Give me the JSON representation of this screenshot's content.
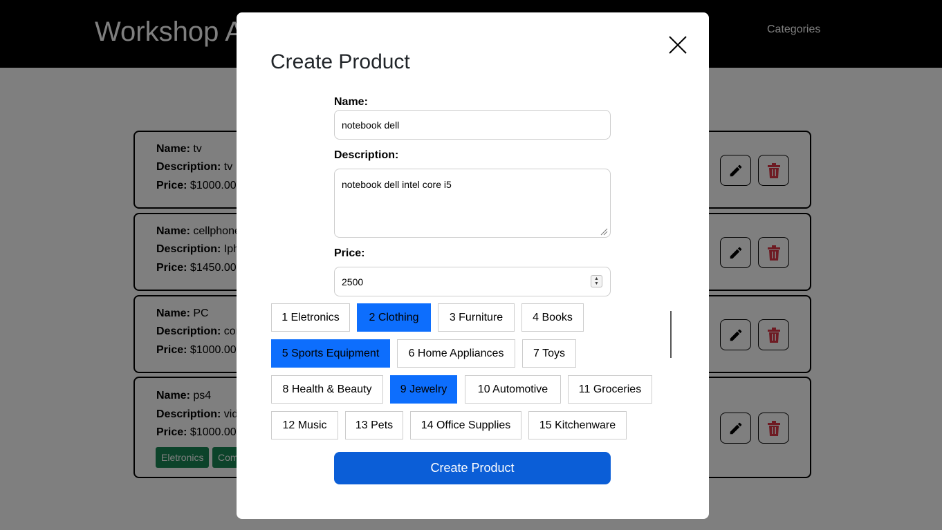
{
  "navbar": {
    "brand": "Workshop A",
    "nav_link": "Categories"
  },
  "labels": {
    "name": "Name:",
    "description": "Description:",
    "price": "Price:"
  },
  "products": [
    {
      "name": "tv",
      "description": "tv L",
      "price": "$1000.00",
      "tags": []
    },
    {
      "name": "cellphone",
      "description": "Iph",
      "price": "$1450.00",
      "tags": []
    },
    {
      "name": "PC",
      "description": "cor",
      "price": "$1000.00",
      "tags": []
    },
    {
      "name": "ps4",
      "description": "vid",
      "price": "$1000.00",
      "tags": [
        "Eletronics",
        "Com"
      ]
    }
  ],
  "modal": {
    "title": "Create Product",
    "name_label": "Name:",
    "name_value": "notebook dell",
    "description_label": "Description:",
    "description_value": "notebook dell intel core i5",
    "price_label": "Price:",
    "price_value": "2500",
    "categories": [
      {
        "label": "1 Eletronics",
        "selected": false
      },
      {
        "label": "2 Clothing",
        "selected": true
      },
      {
        "label": "3 Furniture",
        "selected": false
      },
      {
        "label": "4 Books",
        "selected": false
      },
      {
        "label": "5 Sports Equipment",
        "selected": true
      },
      {
        "label": "6 Home Appliances",
        "selected": false
      },
      {
        "label": "7 Toys",
        "selected": false
      },
      {
        "label": "8 Health & Beauty",
        "selected": false
      },
      {
        "label": "9 Jewelry",
        "selected": true
      },
      {
        "label": "10 Automotive",
        "selected": false
      },
      {
        "label": "11 Groceries",
        "selected": false
      },
      {
        "label": "12 Music",
        "selected": false
      },
      {
        "label": "13 Pets",
        "selected": false
      },
      {
        "label": "14 Office Supplies",
        "selected": false
      },
      {
        "label": "15 Kitchenware",
        "selected": false
      }
    ],
    "submit_label": "Create Product"
  },
  "colors": {
    "selected_category": "#0d6efd",
    "submit": "#0b5ed7",
    "delete_icon": "#dc3545",
    "tag": "#198754"
  },
  "icons": {
    "edit": "pencil-icon",
    "delete": "trash-icon",
    "close": "close-icon"
  }
}
